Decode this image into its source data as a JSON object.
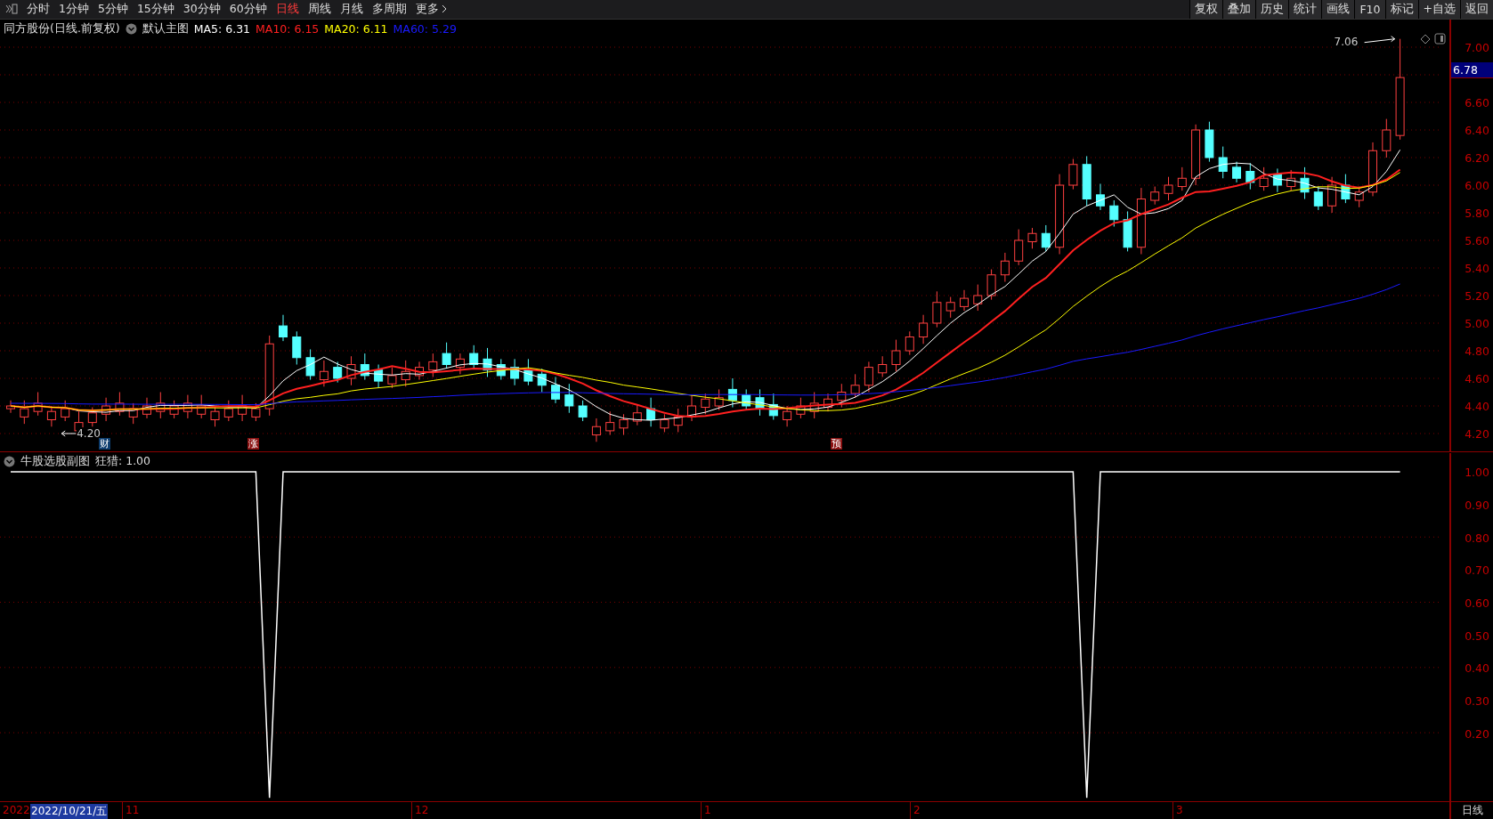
{
  "toolbar": {
    "periods": [
      {
        "label": "分时",
        "selected": false
      },
      {
        "label": "1分钟",
        "selected": false
      },
      {
        "label": "5分钟",
        "selected": false
      },
      {
        "label": "15分钟",
        "selected": false
      },
      {
        "label": "30分钟",
        "selected": false
      },
      {
        "label": "60分钟",
        "selected": false
      },
      {
        "label": "日线",
        "selected": true
      },
      {
        "label": "周线",
        "selected": false
      },
      {
        "label": "月线",
        "selected": false
      },
      {
        "label": "多周期",
        "selected": false
      },
      {
        "label": "更多",
        "selected": false
      }
    ],
    "actions": [
      "复权",
      "叠加",
      "历史",
      "统计",
      "画线",
      "F10",
      "标记",
      "+自选",
      "返回"
    ]
  },
  "main_chart": {
    "stock": "同方股份(日线.前复权)",
    "template": "默认主图",
    "moving_averages": [
      {
        "label": "MA5: 6.31",
        "color": "#ffffff"
      },
      {
        "label": "MA10: 6.15",
        "color": "#ff2020"
      },
      {
        "label": "MA20: 6.11",
        "color": "#ffff00"
      },
      {
        "label": "MA60: 5.29",
        "color": "#1a1aff"
      }
    ],
    "price_axis": [
      "7.00",
      "6.60",
      "6.40",
      "6.20",
      "6.00",
      "5.80",
      "5.60",
      "5.40",
      "5.20",
      "5.00",
      "4.80",
      "4.60",
      "4.40",
      "4.20"
    ],
    "current_price": "6.78",
    "high_marker": "7.06",
    "low_marker": "4.20",
    "event_tags": [
      {
        "label": "财",
        "color": "#0d3d6e"
      },
      {
        "label": "涨",
        "color": "#8a1010"
      },
      {
        "label": "预",
        "color": "#8a1010"
      }
    ]
  },
  "sub_chart": {
    "title": "牛股选股副图",
    "reading": "狂猎: 1.00",
    "chart_data": {
      "type": "line",
      "grid": true,
      "ylim": [
        -0.01,
        1.06
      ],
      "yticks": [
        {
          "value": 1,
          "label": "1.00"
        },
        {
          "value": 0.9,
          "label": "0.90"
        },
        {
          "value": 0.8,
          "label": "0.80"
        },
        {
          "value": 0.7,
          "label": "0.70"
        },
        {
          "value": 0.6,
          "label": "0.60"
        },
        {
          "value": 0.5,
          "label": "0.50"
        },
        {
          "value": 0.4,
          "label": "0.40"
        },
        {
          "value": 0.3,
          "label": "0.30"
        },
        {
          "value": 0.2,
          "label": "0.20"
        }
      ],
      "series": [
        {
          "color": "#ffffff",
          "values": [
            1,
            1,
            1,
            1,
            1,
            1,
            1,
            1,
            1,
            1,
            1,
            1,
            1,
            1,
            1,
            1,
            1,
            1,
            1,
            0,
            1,
            1,
            1,
            1,
            1,
            1,
            1,
            1,
            1,
            1,
            1,
            1,
            1,
            1,
            1,
            1,
            1,
            1,
            1,
            1,
            1,
            1,
            1,
            1,
            1,
            1,
            1,
            1,
            1,
            1,
            1,
            1,
            1,
            1,
            1,
            1,
            1,
            1,
            1,
            1,
            1,
            1,
            1,
            1,
            1,
            1,
            1,
            1,
            1,
            1,
            1,
            1,
            1,
            1,
            1,
            1,
            1,
            1,
            1,
            0,
            1,
            1,
            1,
            1,
            1,
            1,
            1,
            1,
            1,
            1,
            1,
            1,
            1,
            1,
            1,
            1,
            1,
            1,
            1,
            1,
            1,
            1,
            1
          ]
        }
      ]
    }
  },
  "date_axis": {
    "year": "2022",
    "cursor_date": "2022/10/21/五",
    "months": [
      "11",
      "12",
      "1",
      "2",
      "3"
    ],
    "period": "日线"
  }
}
